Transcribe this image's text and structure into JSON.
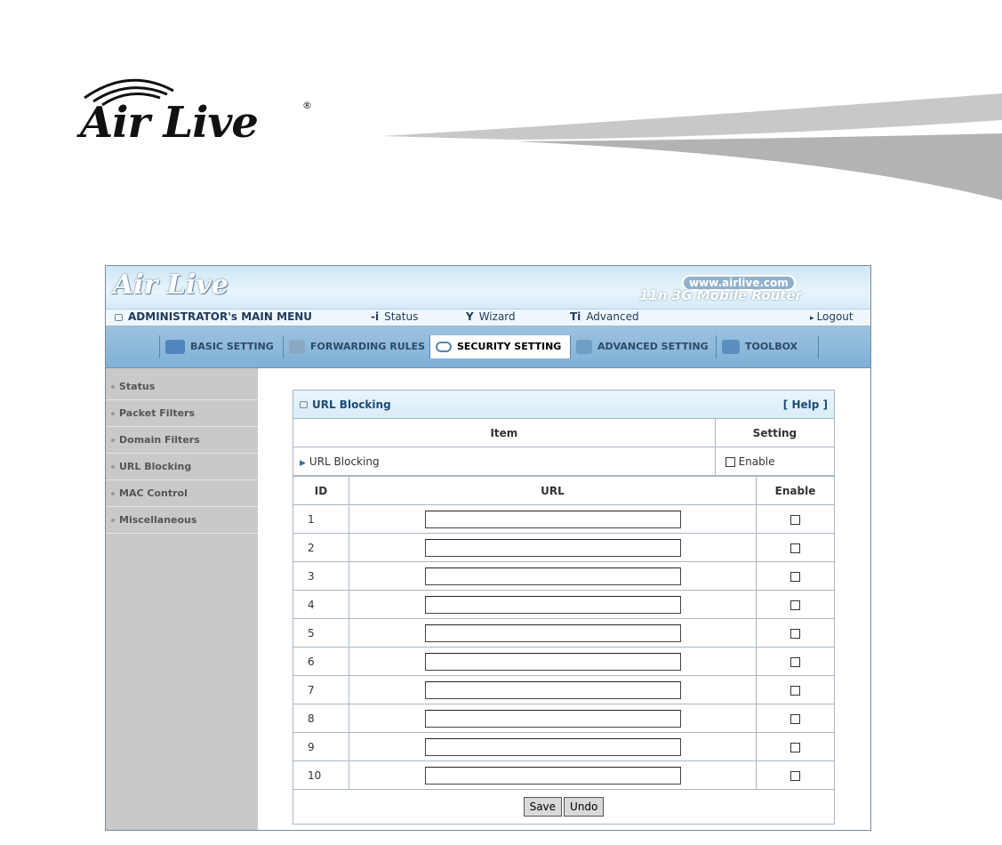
{
  "page": {
    "brand": "Air Live",
    "reg_mark": "®"
  },
  "router": {
    "logo": "Air Live",
    "site": "www.airlive.com",
    "model": "11n 3G Mobile Router"
  },
  "menubar": {
    "main_menu": "ADMINISTRATOR's MAIN MENU",
    "status": "Status",
    "wizard": "Wizard",
    "advanced": "Advanced",
    "logout": "Logout"
  },
  "tabs": [
    {
      "label": "BASIC SETTING"
    },
    {
      "label": "FORWARDING RULES"
    },
    {
      "label": "SECURITY SETTING"
    },
    {
      "label": "ADVANCED SETTING"
    },
    {
      "label": "TOOLBOX"
    }
  ],
  "sidebar": {
    "items": [
      {
        "label": "Status"
      },
      {
        "label": "Packet Filters"
      },
      {
        "label": "Domain Filters"
      },
      {
        "label": "URL Blocking"
      },
      {
        "label": "MAC Control"
      },
      {
        "label": "Miscellaneous"
      }
    ]
  },
  "panel": {
    "title": "URL Blocking",
    "help": "[ Help ]",
    "col_item": "Item",
    "col_setting": "Setting",
    "row_label": "URL Blocking",
    "enable_label": "Enable",
    "col_id": "ID",
    "col_url": "URL",
    "col_enable": "Enable",
    "rows": [
      {
        "id": "1",
        "url": ""
      },
      {
        "id": "2",
        "url": ""
      },
      {
        "id": "3",
        "url": ""
      },
      {
        "id": "4",
        "url": ""
      },
      {
        "id": "5",
        "url": ""
      },
      {
        "id": "6",
        "url": ""
      },
      {
        "id": "7",
        "url": ""
      },
      {
        "id": "8",
        "url": ""
      },
      {
        "id": "9",
        "url": ""
      },
      {
        "id": "10",
        "url": ""
      }
    ],
    "save": "Save",
    "undo": "Undo"
  }
}
